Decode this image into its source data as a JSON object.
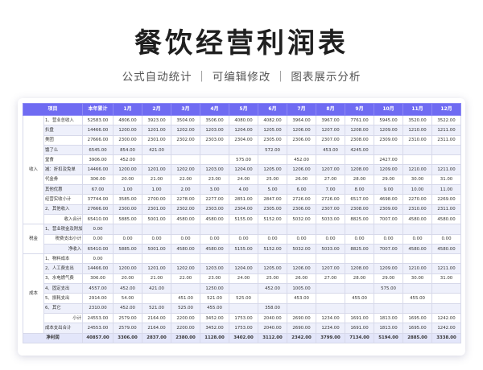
{
  "title": "餐饮经营利润表",
  "subtitle": "公式自动统计 ｜ 可编辑修改 ｜ 图表展示分析",
  "colors": {
    "header": "#6f6bf2",
    "alt_row": "#eef0fb",
    "border": "#d7d9ea"
  },
  "headers": [
    "项目",
    "",
    "本年累计",
    "1月",
    "2月",
    "3月",
    "4月",
    "5月",
    "6月",
    "7月",
    "8月",
    "9月",
    "10月",
    "11月",
    "12月"
  ],
  "groups": [
    {
      "category": "收入",
      "rows": [
        {
          "name": "1、营业总收入",
          "total": "52583.00",
          "months": [
            "4806.00",
            "3923.00",
            "3504.00",
            "3506.00",
            "4080.00",
            "4082.00",
            "3964.00",
            "3967.00",
            "7761.00",
            "5945.00",
            "3520.00",
            "3522.00"
          ]
        },
        {
          "name": "扒盘",
          "total": "14466.00",
          "months": [
            "1200.00",
            "1201.00",
            "1202.00",
            "1203.00",
            "1204.00",
            "1205.00",
            "1206.00",
            "1207.00",
            "1208.00",
            "1209.00",
            "1210.00",
            "1211.00"
          ]
        },
        {
          "name": "美团",
          "total": "27666.00",
          "months": [
            "2300.00",
            "2301.00",
            "2302.00",
            "2303.00",
            "2304.00",
            "2305.00",
            "2306.00",
            "2307.00",
            "2308.00",
            "2309.00",
            "2310.00",
            "2311.00"
          ]
        },
        {
          "name": "饿了么",
          "total": "6545.00",
          "months": [
            "854.00",
            "421.00",
            "",
            "",
            "",
            "572.00",
            "",
            "453.00",
            "4245.00",
            "",
            "",
            ""
          ]
        },
        {
          "name": "堂食",
          "total": "3906.00",
          "months": [
            "452.00",
            "",
            "",
            "",
            "575.00",
            "",
            "452.00",
            "",
            "",
            "2427.00",
            "",
            ""
          ]
        },
        {
          "name": "减：折扣及免单",
          "total": "14466.00",
          "months": [
            "1200.00",
            "1201.00",
            "1202.00",
            "1203.00",
            "1204.00",
            "1205.00",
            "1206.00",
            "1207.00",
            "1208.00",
            "1209.00",
            "1210.00",
            "1211.00"
          ]
        },
        {
          "name": "代金券",
          "total": "306.00",
          "months": [
            "20.00",
            "21.00",
            "22.00",
            "23.00",
            "24.00",
            "25.00",
            "26.00",
            "27.00",
            "28.00",
            "29.00",
            "30.00",
            "31.00"
          ]
        },
        {
          "name": "其他优惠",
          "total": "67.00",
          "months": [
            "1.00",
            "1.00",
            "2.00",
            "3.00",
            "4.00",
            "5.00",
            "6.00",
            "7.00",
            "8.00",
            "9.00",
            "10.00",
            "11.00"
          ]
        },
        {
          "name": "经营实收小计",
          "total": "37744.00",
          "months": [
            "3585.00",
            "2700.00",
            "2278.00",
            "2277.00",
            "2851.00",
            "2847.00",
            "2726.00",
            "2726.00",
            "6517.00",
            "4698.00",
            "2270.00",
            "2269.00"
          ]
        },
        {
          "name": "2、其他收入",
          "total": "27666.00",
          "months": [
            "2300.00",
            "2301.00",
            "2302.00",
            "2303.00",
            "2304.00",
            "2305.00",
            "2306.00",
            "2307.00",
            "2308.00",
            "2309.00",
            "2310.00",
            "2311.00"
          ]
        },
        {
          "name": "收入合计",
          "total": "65410.00",
          "months": [
            "5885.00",
            "5001.00",
            "4580.00",
            "4580.00",
            "5155.00",
            "5152.00",
            "5032.00",
            "5033.00",
            "8825.00",
            "7007.00",
            "4580.00",
            "4580.00"
          ],
          "sub": true
        }
      ]
    },
    {
      "category": "税金",
      "rows": [
        {
          "name": "1、营业税金及附加",
          "total": "0.00",
          "months": [
            "",
            "",
            "",
            "",
            "",
            "",
            "",
            "",
            "",
            "",
            "",
            ""
          ]
        },
        {
          "name": "税费支出小计",
          "total": "0.00",
          "months": [
            "0.00",
            "0.00",
            "0.00",
            "0.00",
            "0.00",
            "0.00",
            "0.00",
            "0.00",
            "0.00",
            "0.00",
            "0.00",
            "0.00"
          ],
          "sub": true
        },
        {
          "name": "净收入",
          "total": "65410.00",
          "months": [
            "5885.00",
            "5001.00",
            "4580.00",
            "4580.00",
            "5155.00",
            "5152.00",
            "5032.00",
            "5033.00",
            "8825.00",
            "7007.00",
            "4580.00",
            "4580.00"
          ],
          "sub": true
        }
      ]
    },
    {
      "category": "成本",
      "rows": [
        {
          "name": "1、物料成本",
          "total": "0.00",
          "months": [
            "",
            "",
            "",
            "",
            "",
            "",
            "",
            "",
            "",
            "",
            "",
            ""
          ]
        },
        {
          "name": "2、人工费支出",
          "total": "14466.00",
          "months": [
            "1200.00",
            "1201.00",
            "1202.00",
            "1203.00",
            "1204.00",
            "1205.00",
            "1206.00",
            "1207.00",
            "1208.00",
            "1209.00",
            "1210.00",
            "1211.00"
          ]
        },
        {
          "name": "3、水电燃气费",
          "total": "306.00",
          "months": [
            "20.00",
            "21.00",
            "22.00",
            "23.00",
            "24.00",
            "25.00",
            "26.00",
            "27.00",
            "28.00",
            "29.00",
            "30.00",
            "31.00"
          ]
        },
        {
          "name": "4、固定支出",
          "total": "4557.00",
          "months": [
            "452.00",
            "421.00",
            "",
            "1250.00",
            "",
            "452.00",
            "1005.00",
            "",
            "",
            "575.00",
            "",
            ""
          ]
        },
        {
          "name": "5、损耗支出",
          "total": "2914.00",
          "months": [
            "54.00",
            "",
            "451.00",
            "521.00",
            "525.00",
            "",
            "453.00",
            "",
            "455.00",
            "",
            "455.00",
            ""
          ]
        },
        {
          "name": "6、其它",
          "total": "2310.00",
          "months": [
            "452.00",
            "521.00",
            "525.00",
            "455.00",
            "",
            "358.00",
            "",
            "",
            "",
            "",
            "",
            ""
          ]
        },
        {
          "name": "小计",
          "total": "24553.00",
          "months": [
            "2579.00",
            "2164.00",
            "2200.00",
            "3452.00",
            "1753.00",
            "2040.00",
            "2690.00",
            "1234.00",
            "1691.00",
            "1813.00",
            "1695.00",
            "1242.00"
          ],
          "sub": true
        },
        {
          "name": "成本支出合计",
          "total": "24553.00",
          "months": [
            "2579.00",
            "2164.00",
            "2200.00",
            "3452.00",
            "1753.00",
            "2040.00",
            "2690.00",
            "1234.00",
            "1691.00",
            "1813.00",
            "1695.00",
            "1242.00"
          ]
        }
      ]
    }
  ],
  "net": {
    "name": "净利润",
    "total": "40857.00",
    "months": [
      "3306.00",
      "2837.00",
      "2380.00",
      "1128.00",
      "3402.00",
      "3112.00",
      "2342.00",
      "3799.00",
      "7134.00",
      "5194.00",
      "2885.00",
      "3338.00"
    ]
  }
}
